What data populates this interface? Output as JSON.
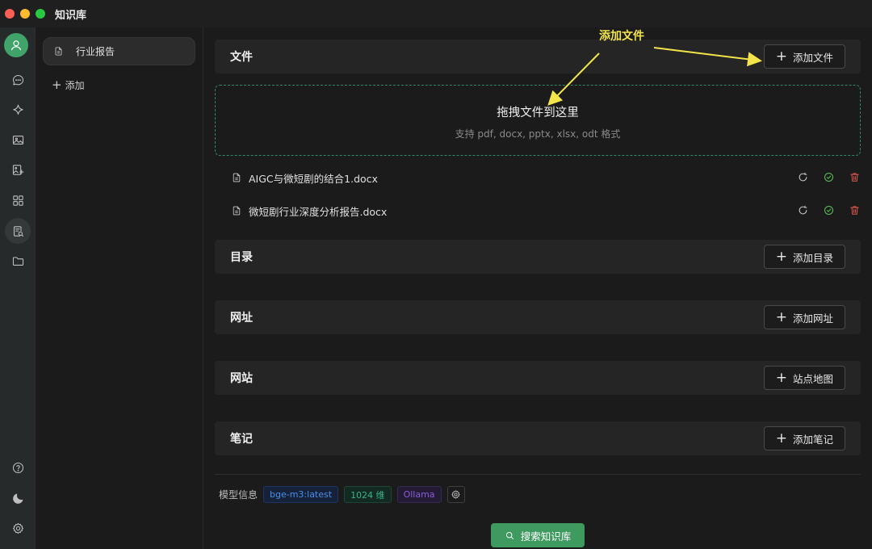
{
  "window": {
    "title": "知识库"
  },
  "annotation": {
    "label": "添加文件"
  },
  "kb_sidebar": {
    "items": [
      {
        "label": "行业报告"
      }
    ],
    "add_label": "添加"
  },
  "sections": {
    "files": {
      "title": "文件",
      "button": "添加文件"
    },
    "directory": {
      "title": "目录",
      "button": "添加目录"
    },
    "url": {
      "title": "网址",
      "button": "添加网址"
    },
    "website": {
      "title": "网站",
      "button": "站点地图"
    },
    "notes": {
      "title": "笔记",
      "button": "添加笔记"
    }
  },
  "dropzone": {
    "title": "拖拽文件到这里",
    "subtitle": "支持 pdf, docx, pptx, xlsx, odt 格式"
  },
  "files": [
    {
      "name": "AIGC与微短剧的结合1.docx"
    },
    {
      "name": "微短剧行业深度分析报告.docx"
    }
  ],
  "model_info": {
    "label": "模型信息",
    "model": "bge-m3:latest",
    "dimensions": "1024 维",
    "provider": "Ollama"
  },
  "search_button": "搜索知识库",
  "colors": {
    "accent_green": "#3e9a5f",
    "annotation_yellow": "#f2e44a",
    "delete_red": "#e05a4e",
    "success_green": "#5cbf5c"
  },
  "icons": {
    "rail": [
      "user-avatar-icon",
      "chat-icon",
      "sparkle-icon",
      "image-icon",
      "image-edit-icon",
      "apps-grid-icon",
      "knowledge-base-icon",
      "folder-icon",
      "help-icon",
      "moon-icon",
      "settings-icon"
    ]
  }
}
